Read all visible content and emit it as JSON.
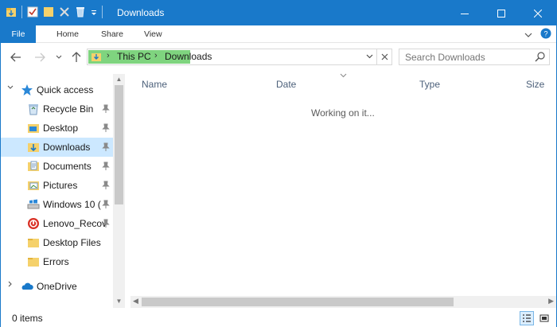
{
  "window": {
    "title": "Downloads",
    "accent_color": "#1979ca"
  },
  "title_controls": {
    "minimize": "—",
    "maximize": "☐",
    "close": "✕"
  },
  "ribbon": {
    "tabs": [
      "File",
      "Home",
      "Share",
      "View"
    ],
    "expand_icon": "chevron-down-icon",
    "help_icon": "help-icon"
  },
  "address": {
    "segments": [
      "This PC",
      "Downloads"
    ],
    "separator": "›"
  },
  "search": {
    "placeholder": "Search Downloads"
  },
  "nav_pane": {
    "items": [
      {
        "label": "Quick access",
        "icon": "star-icon",
        "pinned": false,
        "expander": "⌄"
      },
      {
        "label": "Recycle Bin",
        "icon": "recycle-bin-icon",
        "pinned": true
      },
      {
        "label": "Desktop",
        "icon": "desktop-folder-icon",
        "pinned": true
      },
      {
        "label": "Downloads",
        "icon": "downloads-folder-icon",
        "pinned": true,
        "selected": true
      },
      {
        "label": "Documents",
        "icon": "documents-icon",
        "pinned": true
      },
      {
        "label": "Pictures",
        "icon": "pictures-icon",
        "pinned": true
      },
      {
        "label": "Windows 10 (",
        "icon": "drive-icon",
        "pinned": true
      },
      {
        "label": "Lenovo_Recov",
        "icon": "lenovo-drive-icon",
        "pinned": true
      },
      {
        "label": "Desktop Files",
        "icon": "folder-icon",
        "pinned": false
      },
      {
        "label": "Errors",
        "icon": "folder-icon",
        "pinned": false
      },
      {
        "label": "OneDrive",
        "icon": "onedrive-icon",
        "pinned": false,
        "expander": "›"
      }
    ]
  },
  "columns": [
    "Name",
    "Date",
    "Type",
    "Size"
  ],
  "content": {
    "status_message": "Working on it..."
  },
  "status": {
    "item_count": "0 items"
  }
}
